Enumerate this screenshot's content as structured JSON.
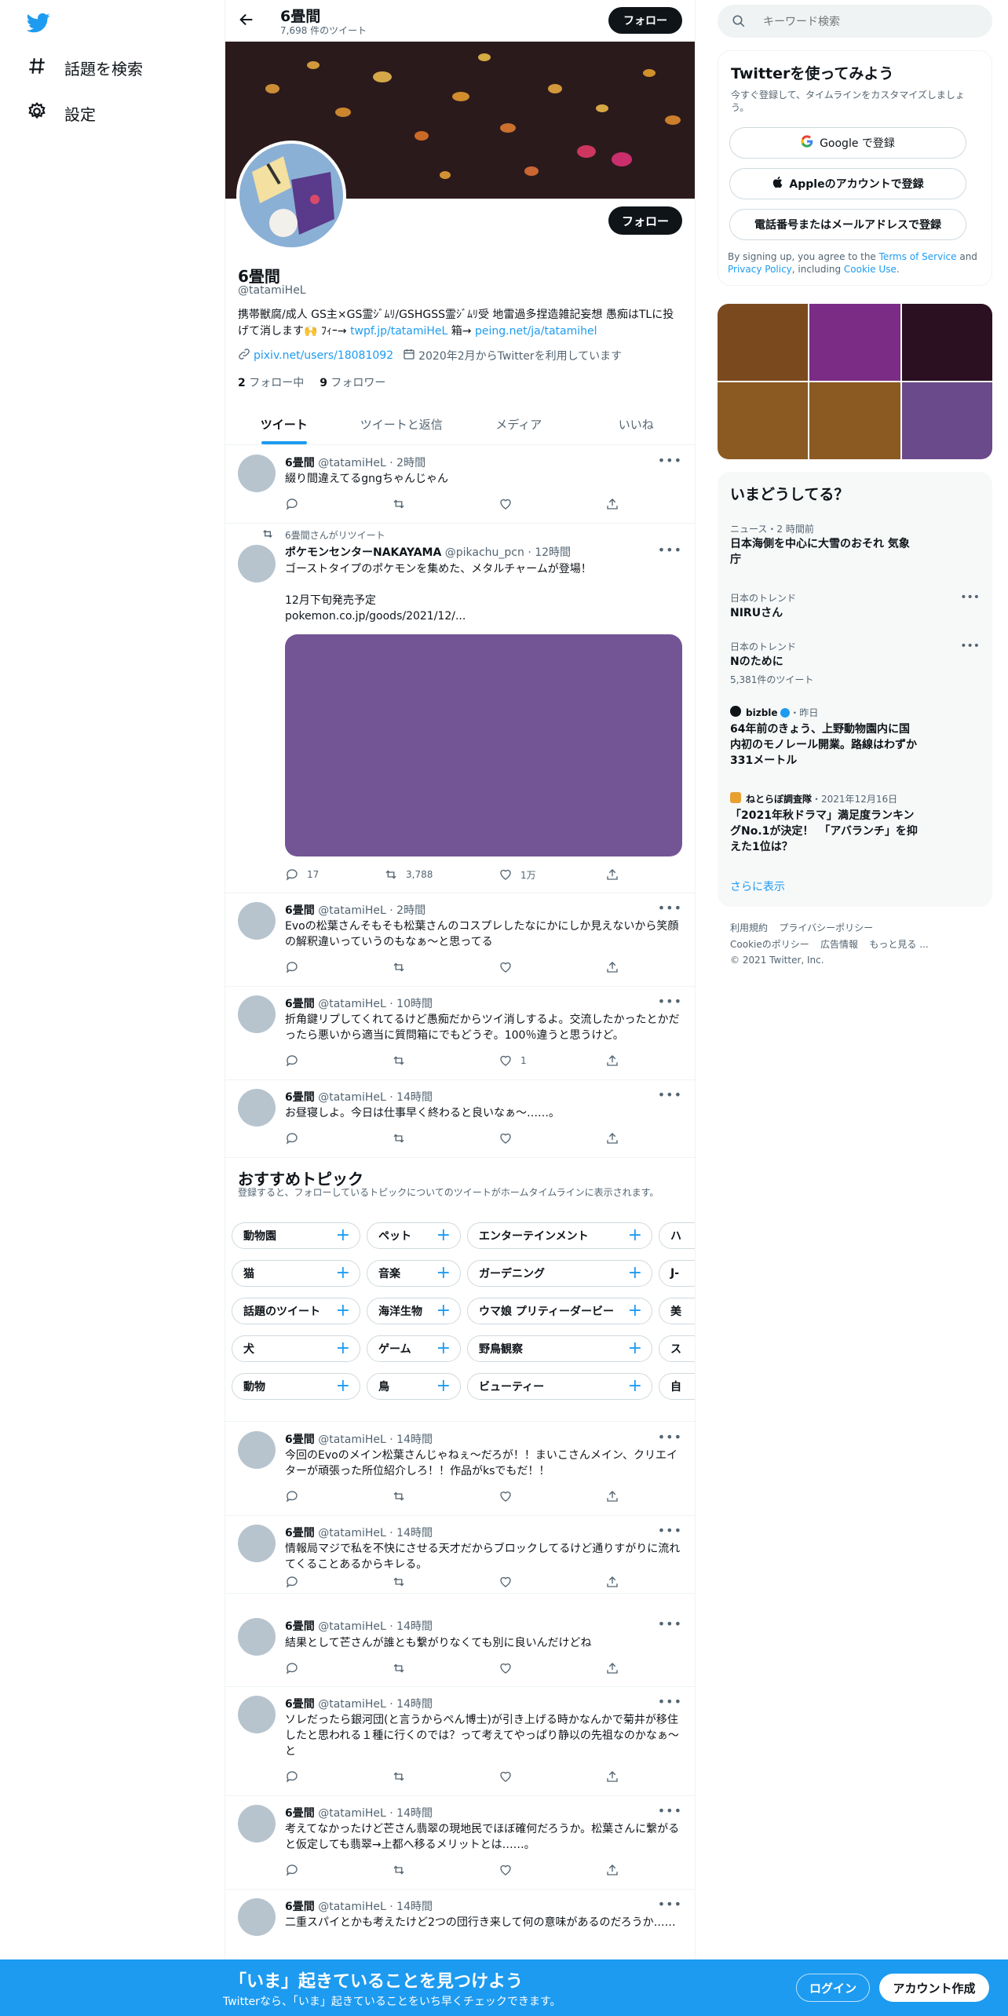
{
  "nav": {
    "explore": "話題を検索",
    "settings": "設定"
  },
  "header": {
    "name": "6畳間",
    "tweet_count": "7,698 件のツイート",
    "follow": "フォロー"
  },
  "profile": {
    "name": "6畳間",
    "handle": "@tatamiHeL",
    "follow": "フォロー",
    "bio_main": "携帯獣腐/成人 GS主×GS霊ｼﾞﾑﾘ/GSHGSS霊ｼﾞﾑﾘ受 地雷過多捏造雑記妄想 愚痴はTLに投げて消します🙌 ﾌｨｰ→ ",
    "bio_link1": "twpf.jp/tatamiHeL",
    "bio_mid": " 箱→ ",
    "bio_link2": "peing.net/ja/tatamihel",
    "link": "pixiv.net/users/18081092",
    "joined": "2020年2月からTwitterを利用しています",
    "following_count": "2",
    "following_label": "フォロー中",
    "followers_count": "9",
    "followers_label": "フォロワー"
  },
  "tabs": [
    "ツイート",
    "ツイートと返信",
    "メディア",
    "いいね"
  ],
  "tweets": [
    {
      "name": "6畳間",
      "handle": "@tatamiHeL",
      "time": "2時間",
      "text": "綴り間違えてるgngちゃんじゃん"
    },
    {
      "retweet_label": "6畳間さんがリツイート",
      "name": "ポケモンセンターNAKAYAMA",
      "handle": "@pikachu_pcn",
      "time": "12時間",
      "text1": "ゴーストタイプのポケモンを集めた、メタルチャームが登場！",
      "text2": "12月下旬発売予定",
      "link": "pokemon.co.jp/goods/2021/12/...",
      "replies": "17",
      "retweets": "3,788",
      "likes": "1万"
    },
    {
      "name": "6畳間",
      "handle": "@tatamiHeL",
      "time": "2時間",
      "text": "Evoの松葉さんそもそも松葉さんのコスプレしたなにかにしか見えないから笑顔の解釈違いっていうのもなぁ～と思ってる"
    },
    {
      "name": "6畳間",
      "handle": "@tatamiHeL",
      "time": "10時間",
      "text": "折角鍵リプしてくれてるけど愚痴だからツイ消しするよ。交流したかったとかだったら悪いから適当に質問箱にでもどうぞ。100％違うと思うけど。",
      "likes": "1"
    },
    {
      "name": "6畳間",
      "handle": "@tatamiHeL",
      "time": "14時間",
      "text": "お昼寝しよ。今日は仕事早く終わると良いなぁ～……。"
    },
    {
      "name": "6畳間",
      "handle": "@tatamiHeL",
      "time": "14時間",
      "text": "今回のEvoのメイン松葉さんじゃねぇ～だろが！！まいこさんメイン、クリエイターが頑張った所位紹介しろ！！作品がksでもだ！！"
    },
    {
      "name": "6畳間",
      "handle": "@tatamiHeL",
      "time": "14時間",
      "text": "情報局マジで私を不快にさせる天才だからブロックしてるけど通りすがりに流れてくることあるからキレる。"
    },
    {
      "name": "6畳間",
      "handle": "@tatamiHeL",
      "time": "14時間",
      "text": "結果として芒さんが誰とも繋がりなくても別に良いんだけどね"
    },
    {
      "name": "6畳間",
      "handle": "@tatamiHeL",
      "time": "14時間",
      "text": "ソレだったら銀河団(と言うからぺん博士)が引き上げる時かなんかで菊井が移住したと思われる１種に行くのでは？って考えてやっぱり静以の先祖なのかなぁ～と"
    },
    {
      "name": "6畳間",
      "handle": "@tatamiHeL",
      "time": "14時間",
      "text": "考えてなかったけど芒さん翡翠の現地民でほぼ確何だろうか。松葉さんに繋がると仮定しても翡翠→上都へ移るメリットとは……。"
    },
    {
      "name": "6畳間",
      "handle": "@tatamiHeL",
      "time": "14時間",
      "text": "二重スパイとかも考えたけど2つの団行き来して何の意味があるのだろうか……"
    }
  ],
  "topics": {
    "title": "おすすめトピック",
    "subtitle": "登録すると、フォローしているトピックについてのツイートがホームタイムラインに表示されます。",
    "rows": [
      [
        "動物園",
        "ペット",
        "エンターテインメント",
        "ハ"
      ],
      [
        "猫",
        "音楽",
        "ガーデニング",
        "J-"
      ],
      [
        "話題のツイート",
        "海洋生物",
        "ウマ娘 プリティーダービー",
        "美"
      ],
      [
        "犬",
        "ゲーム",
        "野鳥観察",
        "ス"
      ],
      [
        "動物",
        "鳥",
        "ビューティー",
        "自"
      ]
    ]
  },
  "search": {
    "placeholder": "キーワード検索"
  },
  "signup": {
    "title": "Twitterを使ってみよう",
    "subtitle": "今すぐ登録して、タイムラインをカスタマイズしましょう。",
    "google": "Google で登録",
    "apple": "Appleのアカウントで登録",
    "phone": "電話番号またはメールアドレスで登録",
    "legal_pre": "By signing up, you agree to the ",
    "terms": "Terms of Service",
    "legal_and": " and ",
    "privacy": "Privacy Policy",
    "legal_incl": ", including ",
    "cookie": "Cookie Use",
    "legal_end": "."
  },
  "media_colors": [
    "#7a4a1e",
    "#7b2d86",
    "#2a1020",
    "#8a5a22",
    "#8a5a22",
    "#6a4a8a"
  ],
  "trends": {
    "title": "いまどうしてる？",
    "items": [
      {
        "category": "ニュース・2 時間前",
        "title": "日本海側を中心に大雪のおそれ 気象庁"
      },
      {
        "category": "日本のトレンド",
        "title": "NIRUさん"
      },
      {
        "category": "日本のトレンド",
        "title": "Nのために",
        "count": "5,381件のツイート"
      },
      {
        "source": "bizble",
        "time": "・昨日",
        "title": "64年前のきょう、上野動物園内に国内初のモノレール開業。路線はわずか331メートル"
      },
      {
        "source": "ねとらぼ調査隊",
        "time": "・2021年12月16日",
        "title": "「2021年秋ドラマ」満足度ランキングNo.1が決定！　「アバランチ」を抑えた1位は？"
      }
    ],
    "show_more": "さらに表示"
  },
  "footer": {
    "line1": [
      "利用規約",
      "プライバシーポリシー"
    ],
    "line2": [
      "Cookieのポリシー",
      "広告情報",
      "もっと見る ..."
    ],
    "copyright": "© 2021 Twitter, Inc."
  },
  "bottom": {
    "title": "「いま」起きていることを見つけよう",
    "subtitle": "Twitterなら、「いま」起きていることをいち早くチェックできます。",
    "login": "ログイン",
    "signup": "アカウント作成"
  },
  "colors": {
    "accent": "#1d9bf0",
    "dark": "#0f1419",
    "tweet_media": "#735596"
  }
}
